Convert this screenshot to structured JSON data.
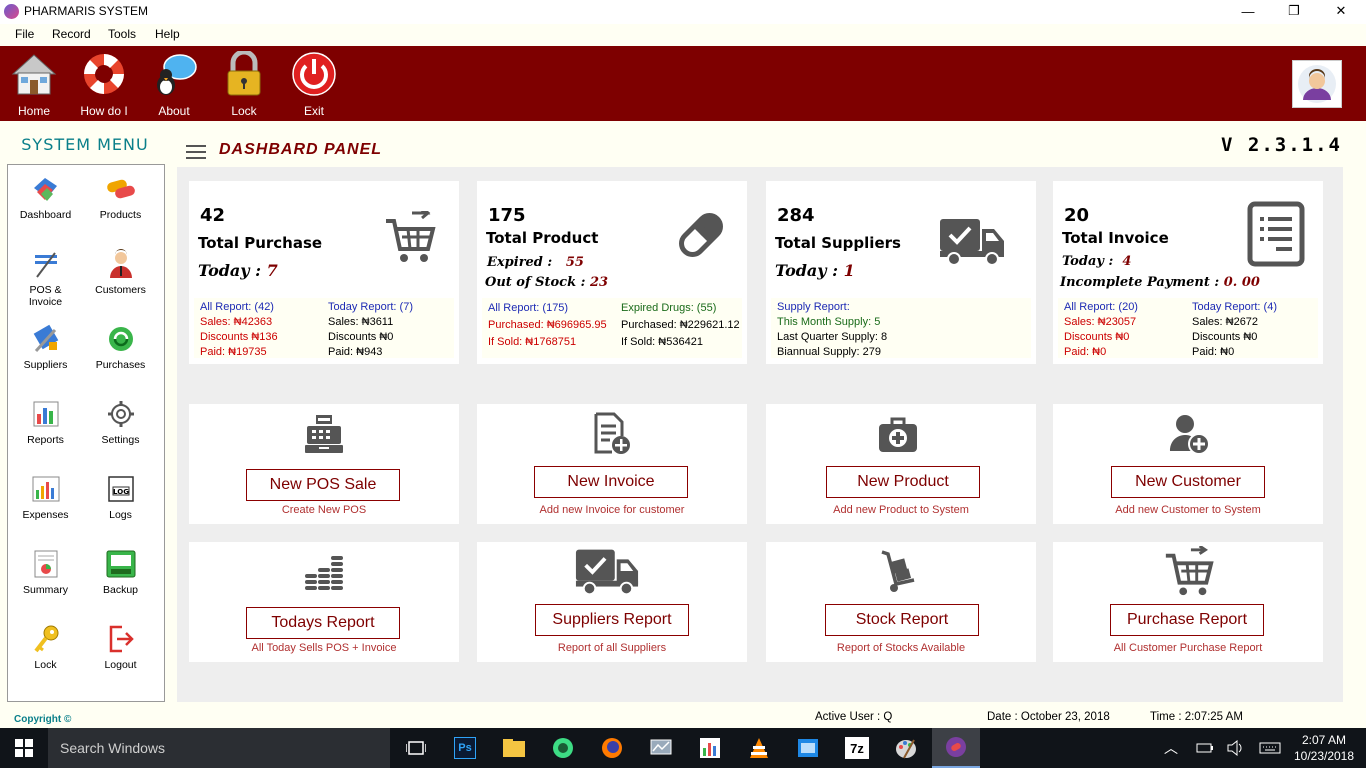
{
  "app": {
    "title": "PHARMARIS SYSTEM"
  },
  "window": {
    "minimize": "—",
    "restore": "❐",
    "close": "✕"
  },
  "menu": [
    "File",
    "Record",
    "Tools",
    "Help"
  ],
  "toolbar": [
    {
      "label": "Home",
      "icon": "house-icon"
    },
    {
      "label": "How do I",
      "icon": "lifebuoy-icon"
    },
    {
      "label": "About",
      "icon": "chat-bubble-icon"
    },
    {
      "label": "Lock",
      "icon": "padlock-icon"
    },
    {
      "label": "Exit",
      "icon": "power-icon"
    }
  ],
  "sidebar": {
    "heading": "SYSTEM MENU",
    "items": [
      {
        "label": "Dashboard",
        "icon": "dashboard-icon"
      },
      {
        "label": "Products",
        "icon": "pills-icon"
      },
      {
        "label": "POS &\nInvoice",
        "icon": "pos-icon"
      },
      {
        "label": "Customers",
        "icon": "person-icon"
      },
      {
        "label": "Suppliers",
        "icon": "tools-icon"
      },
      {
        "label": "Purchases",
        "icon": "recycle-icon"
      },
      {
        "label": "Reports",
        "icon": "bar-chart-icon"
      },
      {
        "label": "Settings",
        "icon": "gear-icon"
      },
      {
        "label": "Expenses",
        "icon": "chart-icon"
      },
      {
        "label": "Logs",
        "icon": "log-icon"
      },
      {
        "label": "Summary",
        "icon": "summary-icon"
      },
      {
        "label": "Backup",
        "icon": "backup-icon"
      },
      {
        "label": "Lock",
        "icon": "key-icon"
      },
      {
        "label": "Logout",
        "icon": "logout-icon"
      }
    ]
  },
  "panel": {
    "title": "DASHBARD  PANEL",
    "version": "V 2.3.1.4"
  },
  "stats": {
    "purchase": {
      "count": "42",
      "label": "Total Purchase",
      "today_label": "Today :",
      "today_value": "7",
      "all_report": "All Report: (42)",
      "sales": "Sales: ₦42363",
      "discounts": "Discounts ₦136",
      "paid": "Paid: ₦19735",
      "today_report": "Today Report: (7)",
      "t_sales": "Sales: ₦3611",
      "t_discounts": "Discounts ₦0",
      "t_paid": "Paid: ₦943"
    },
    "product": {
      "count": "175",
      "label": "Total Product",
      "expired_label": "Expired :",
      "expired_value": "55",
      "oos_label": "Out of Stock :",
      "oos_value": "23",
      "all_report": "All Report: (175)",
      "purchased": "Purchased: ₦696965.95",
      "if_sold": "If Sold: ₦1768751",
      "expired_drugs": "Expired Drugs: (55)",
      "e_purchased": "Purchased: ₦229621.12",
      "e_if_sold": "If Sold: ₦536421"
    },
    "suppliers": {
      "count": "284",
      "label": "Total Suppliers",
      "today_label": "Today :",
      "today_value": "1",
      "supply_report": "Supply Report:",
      "month": "This Month Supply: 5",
      "quarter": "Last Quarter Supply:  8",
      "biannual": "Biannual  Supply: 279"
    },
    "invoice": {
      "count": "20",
      "label": "Total Invoice",
      "today_label": "Today :",
      "today_value": "4",
      "incomplete_label": "Incomplete Payment :",
      "incomplete_value": "0. 00",
      "all_report": "All Report: (20)",
      "sales": "Sales: ₦23057",
      "discounts": "Discounts ₦0",
      "paid": "Paid: ₦0",
      "today_report": "Today Report: (4)",
      "t_sales": "Sales: ₦2672",
      "t_discounts": "Discounts ₦0",
      "t_paid": "Paid: ₦0"
    }
  },
  "actions": [
    {
      "button": "New POS Sale",
      "sub": "Create New POS",
      "icon": "cash-register-icon"
    },
    {
      "button": "New Invoice",
      "sub": "Add new Invoice for customer",
      "icon": "file-add-icon"
    },
    {
      "button": "New Product",
      "sub": "Add new Product to System",
      "icon": "medical-kit-icon"
    },
    {
      "button": "New Customer",
      "sub": "Add new Customer to System",
      "icon": "user-add-icon"
    },
    {
      "button": "Todays Report",
      "sub": "All Today Sells POS + Invoice",
      "icon": "coins-icon"
    },
    {
      "button": "Suppliers Report",
      "sub": "Report of all Suppliers",
      "icon": "truck-icon"
    },
    {
      "button": "Stock Report",
      "sub": "Report of Stocks Available",
      "icon": "hand-truck-icon"
    },
    {
      "button": "Purchase Report",
      "sub": "All Customer Purchase Report",
      "icon": "cart-icon"
    }
  ],
  "status": {
    "copyright": "Copyright ©",
    "active_user": "Active User :  Q",
    "date": "Date :  October 23, 2018",
    "time": "Time :  2:07:25 AM"
  },
  "taskbar": {
    "search": "Search Windows",
    "clock_time": "2:07 AM",
    "clock_date": "10/23/2018"
  },
  "colors": {
    "brand": "#7e0000",
    "accent": "#0a7f8a"
  }
}
